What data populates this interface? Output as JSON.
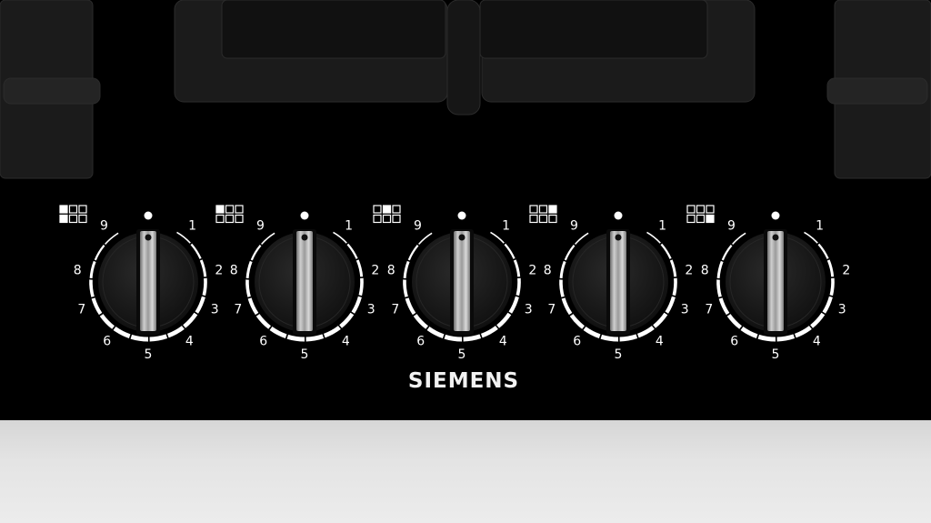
{
  "brand": "SIEMENS",
  "knobs": [
    {
      "pos": 0,
      "burner_map": [
        1,
        0,
        0,
        1,
        0,
        0
      ],
      "scale": [
        "1",
        "2",
        "3",
        "4",
        "5",
        "6",
        "7",
        "8",
        "9"
      ]
    },
    {
      "pos": 1,
      "burner_map": [
        1,
        0,
        0,
        0,
        0,
        0
      ],
      "scale": [
        "1",
        "2",
        "3",
        "4",
        "5",
        "6",
        "7",
        "8",
        "9"
      ]
    },
    {
      "pos": 2,
      "burner_map": [
        0,
        1,
        0,
        0,
        0,
        0
      ],
      "scale": [
        "1",
        "2",
        "3",
        "4",
        "5",
        "6",
        "7",
        "8",
        "9"
      ]
    },
    {
      "pos": 3,
      "burner_map": [
        0,
        0,
        1,
        0,
        0,
        0
      ],
      "scale": [
        "1",
        "2",
        "3",
        "4",
        "5",
        "6",
        "7",
        "8",
        "9"
      ]
    },
    {
      "pos": 4,
      "burner_map": [
        0,
        0,
        0,
        0,
        0,
        1
      ],
      "scale": [
        "1",
        "2",
        "3",
        "4",
        "5",
        "6",
        "7",
        "8",
        "9"
      ]
    }
  ],
  "colors": {
    "glass": "#000000",
    "grate": "#1c1c1c",
    "knob": "#1a1a1a",
    "markings": "#ffffff",
    "steel": "#b8b8b8",
    "counter": "#e2e2e2"
  }
}
